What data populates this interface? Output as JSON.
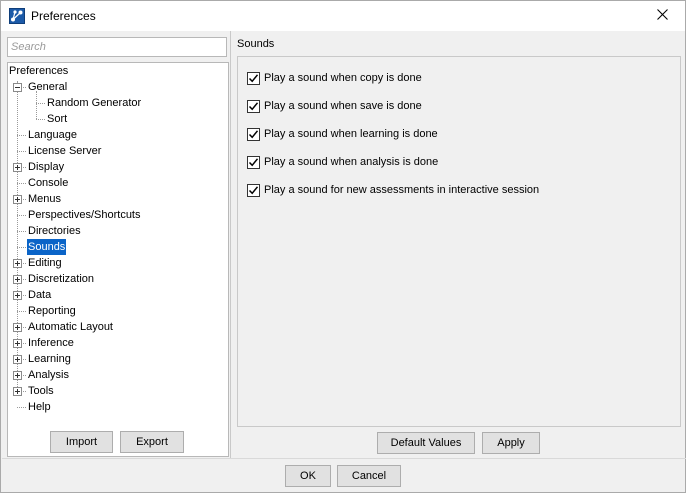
{
  "window": {
    "title": "Preferences"
  },
  "search": {
    "placeholder": "Search"
  },
  "tree": {
    "root": "Preferences",
    "items": [
      {
        "label": "General",
        "expander": "minus"
      },
      {
        "label": "Random Generator",
        "expander": "none"
      },
      {
        "label": "Sort",
        "expander": "none"
      },
      {
        "label": "Language",
        "expander": "none"
      },
      {
        "label": "License Server",
        "expander": "none"
      },
      {
        "label": "Display",
        "expander": "plus"
      },
      {
        "label": "Console",
        "expander": "none"
      },
      {
        "label": "Menus",
        "expander": "plus"
      },
      {
        "label": "Perspectives/Shortcuts",
        "expander": "none"
      },
      {
        "label": "Directories",
        "expander": "none"
      },
      {
        "label": "Sounds",
        "expander": "none",
        "selected": true
      },
      {
        "label": "Editing",
        "expander": "plus"
      },
      {
        "label": "Discretization",
        "expander": "plus"
      },
      {
        "label": "Data",
        "expander": "plus"
      },
      {
        "label": "Reporting",
        "expander": "none"
      },
      {
        "label": "Automatic Layout",
        "expander": "plus"
      },
      {
        "label": "Inference",
        "expander": "plus"
      },
      {
        "label": "Learning",
        "expander": "plus"
      },
      {
        "label": "Analysis",
        "expander": "plus"
      },
      {
        "label": "Tools",
        "expander": "plus"
      },
      {
        "label": "Help",
        "expander": "none"
      }
    ]
  },
  "left_buttons": {
    "import": "Import",
    "export": "Export"
  },
  "sounds": {
    "title": "Sounds",
    "options": [
      {
        "label": "Play a sound when copy is done",
        "checked": true
      },
      {
        "label": "Play a sound when save is done",
        "checked": true
      },
      {
        "label": "Play a sound when learning is done",
        "checked": true
      },
      {
        "label": "Play a sound when analysis is done",
        "checked": true
      },
      {
        "label": "Play a sound for new assessments in interactive session",
        "checked": true
      }
    ],
    "default_values": "Default Values",
    "apply": "Apply"
  },
  "dialog_buttons": {
    "ok": "OK",
    "cancel": "Cancel"
  },
  "colors": {
    "selection": "#0a64c8",
    "icon": "#1c5aa8"
  }
}
